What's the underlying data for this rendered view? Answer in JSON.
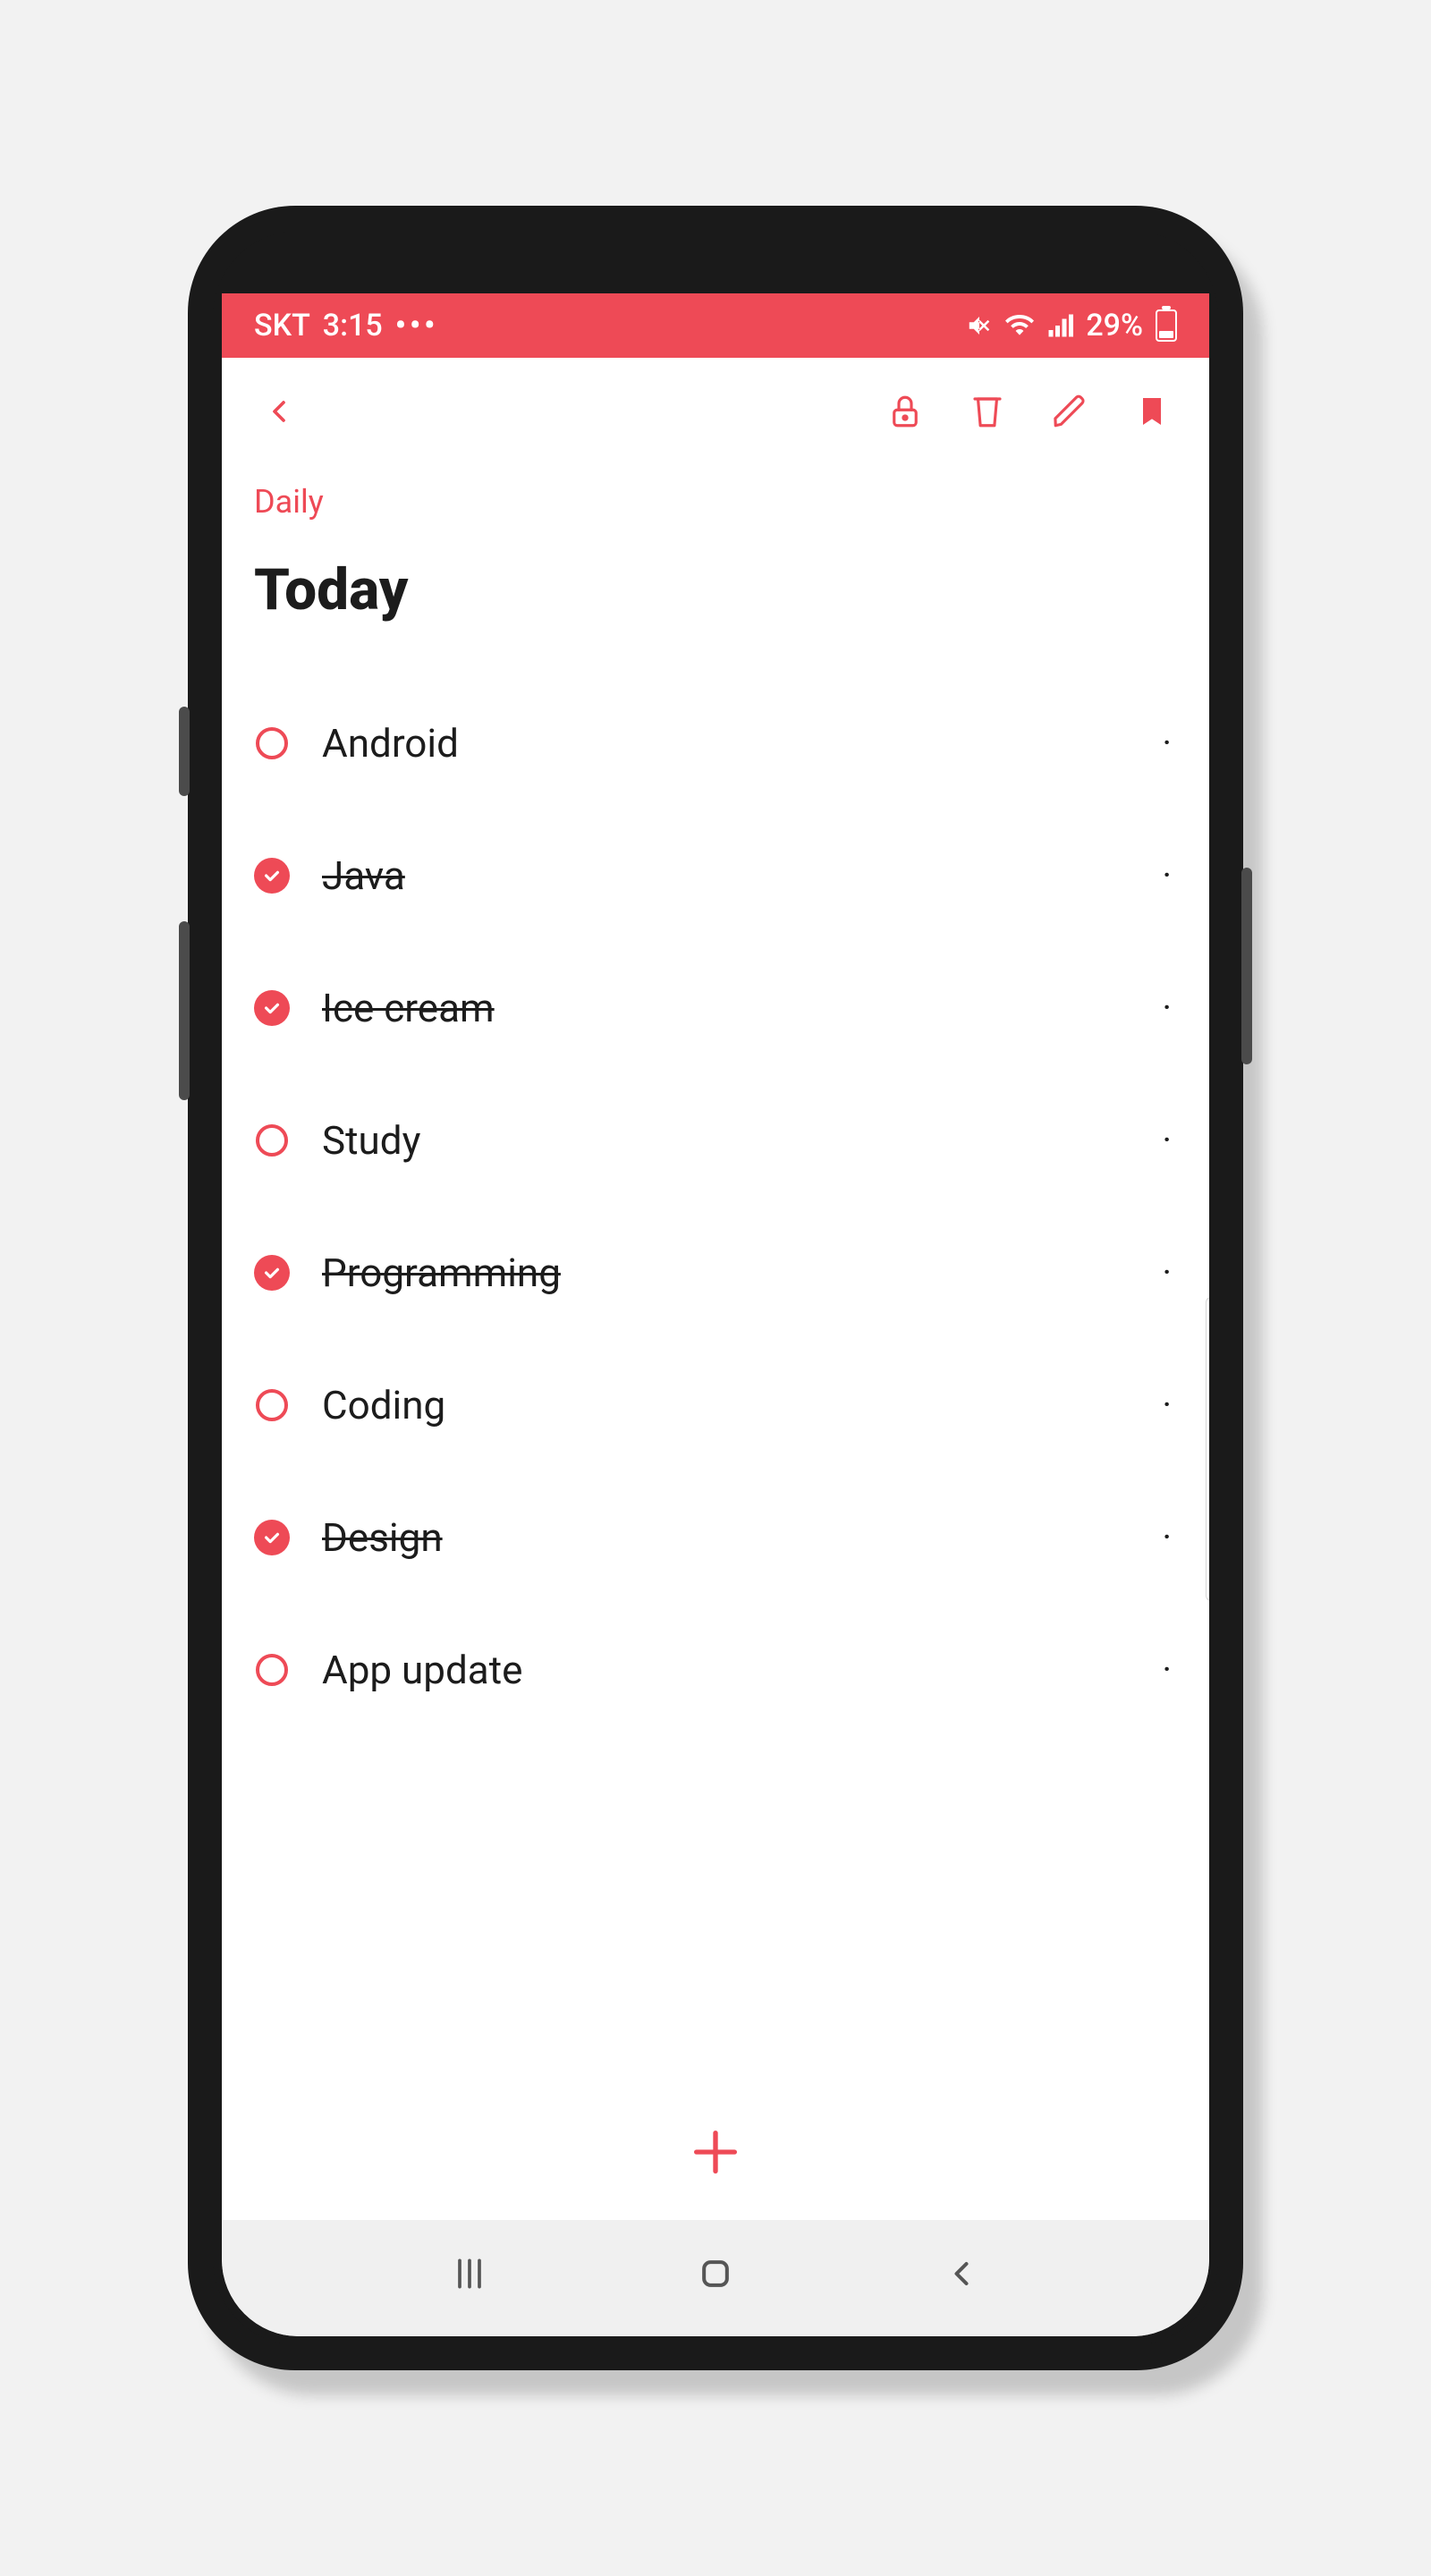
{
  "colors": {
    "accent": "#ee4a56"
  },
  "status_bar": {
    "carrier": "SKT",
    "time": "3:15",
    "dots": "•••",
    "battery_percent": "29%"
  },
  "header": {
    "category": "Daily",
    "title": "Today"
  },
  "tasks": [
    {
      "label": "Android",
      "done": false
    },
    {
      "label": "Java",
      "done": true
    },
    {
      "label": "Ice cream",
      "done": true
    },
    {
      "label": "Study",
      "done": false
    },
    {
      "label": "Programming",
      "done": true
    },
    {
      "label": "Coding",
      "done": false
    },
    {
      "label": "Design",
      "done": true
    },
    {
      "label": "App update",
      "done": false
    }
  ],
  "toolbar_icons": {
    "back": "back-icon",
    "lock": "lock-icon",
    "trash": "trash-icon",
    "edit": "pencil-icon",
    "bookmark": "bookmark-icon"
  },
  "nav_icons": {
    "recents": "recents-icon",
    "home": "home-icon",
    "back": "back-nav-icon"
  },
  "add_icon": "plus-icon"
}
